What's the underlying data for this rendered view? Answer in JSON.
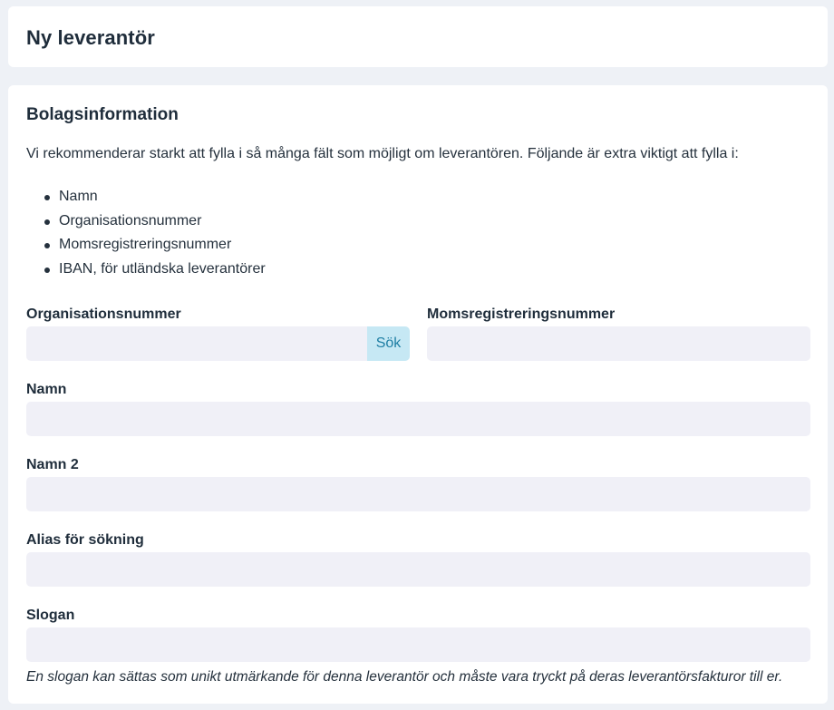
{
  "page": {
    "title": "Ny leverantör"
  },
  "company_section": {
    "title": "Bolagsinformation",
    "intro": "Vi rekommenderar starkt att fylla i så många fält som möjligt om leverantören. Följande är extra viktigt att fylla i:",
    "bullets": [
      "Namn",
      "Organisationsnummer",
      "Momsregistreringsnummer",
      "IBAN, för utländska leverantörer"
    ]
  },
  "form": {
    "org_number": {
      "label": "Organisationsnummer",
      "value": "",
      "search_button": "Sök"
    },
    "vat_number": {
      "label": "Momsregistreringsnummer",
      "value": ""
    },
    "name": {
      "label": "Namn",
      "value": ""
    },
    "name2": {
      "label": "Namn 2",
      "value": ""
    },
    "alias": {
      "label": "Alias för sökning",
      "value": ""
    },
    "slogan": {
      "label": "Slogan",
      "value": "",
      "hint": "En slogan kan sättas som unikt utmärkande för denna leverantör och måste vara tryckt på deras leverantörsfakturor till er."
    }
  },
  "colors": {
    "background": "#eef1f6",
    "card": "#ffffff",
    "input_bg": "#f0f0f7",
    "search_button_bg": "#c6e8f4",
    "search_button_text": "#1f7fa4",
    "text": "#1f2d3b"
  }
}
